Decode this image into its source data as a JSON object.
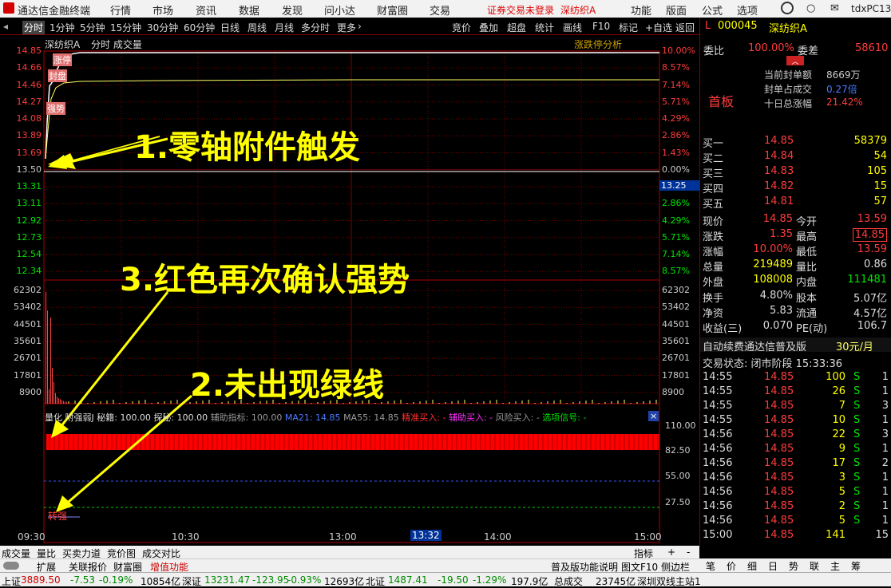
{
  "menubar": {
    "app_title": "通达信金融终端",
    "items": [
      "行情",
      "市场",
      "资讯",
      "数据",
      "发现",
      "问小达",
      "财富圈",
      "交易"
    ],
    "alert": "证券交易未登录",
    "stock": "深纺织A",
    "right_items": [
      "功能",
      "版面",
      "公式",
      "选项"
    ],
    "user": "tdxPC13"
  },
  "period_bar": {
    "items": [
      "分时",
      "1分钟",
      "5分钟",
      "15分钟",
      "30分钟",
      "60分钟",
      "日线",
      "周线",
      "月线",
      "多分时",
      "更多"
    ],
    "tools": [
      "竞价",
      "叠加",
      "超盘",
      "统计",
      "画线",
      "F10",
      "标记",
      "+自选",
      "返回"
    ]
  },
  "chart": {
    "header": "深纺织A",
    "header2": "分时 成交量",
    "limit_link": "涨跌停分析",
    "price_ticks": [
      "14.85",
      "14.66",
      "14.46",
      "14.27",
      "14.08",
      "13.89",
      "13.69",
      "13.50",
      "13.31",
      "13.11",
      "12.92",
      "12.73",
      "12.54",
      "12.34"
    ],
    "pct_ticks": [
      "10.00%",
      "8.57%",
      "7.14%",
      "5.71%",
      "4.29%",
      "2.86%",
      "1.43%",
      "0.00%",
      "1.43%",
      "2.86%",
      "4.29%",
      "5.71%",
      "7.14%",
      "8.57%"
    ],
    "cursor_price": "13.25",
    "vol_ticks": [
      "62302",
      "53402",
      "44501",
      "35601",
      "26701",
      "17801",
      "8900"
    ],
    "ind_ticks": [
      "110.00",
      "82.50",
      "55.00",
      "27.50"
    ],
    "time_ticks": [
      "09:30",
      "10:30",
      "13:00",
      "14:00",
      "15:00"
    ],
    "cursor_time": "13:32",
    "tags": [
      "涨停",
      "封盘",
      "强势"
    ],
    "indicator_line": [
      "量化",
      "附强弱J 秘籍: 100.00",
      "探秘: 100.00",
      "辅助指标: 100.00",
      "MA21: 14.85",
      "MA55: 14.85",
      "精准买入: -",
      "辅助买入: -",
      "风险买入: -",
      "选项信号: -"
    ],
    "indicator_tag": "转强",
    "notes": [
      "1.零轴附件触发",
      "3.红色再次确认强势",
      "2.未出现绿线"
    ]
  },
  "right": {
    "code": "000045",
    "name": "深纺织A",
    "weibi_label": "委比",
    "weibi": "100.00%",
    "weicha_label": "委差",
    "weicha": "58610",
    "seal_rows": [
      [
        "当前封单额",
        "8669万"
      ],
      [
        "封单占成交",
        "0.27倍"
      ],
      [
        "十日总涨幅",
        "21.42%"
      ]
    ],
    "board": "首板",
    "bids": [
      [
        "买一",
        "14.85",
        "58379"
      ],
      [
        "买二",
        "14.84",
        "54"
      ],
      [
        "买三",
        "14.83",
        "105"
      ],
      [
        "买四",
        "14.82",
        "15"
      ],
      [
        "买五",
        "14.81",
        "57"
      ]
    ],
    "quote": [
      [
        "现价",
        "14.85",
        "今开",
        "13.59"
      ],
      [
        "涨跌",
        "1.35",
        "最高",
        "14.85"
      ],
      [
        "涨幅",
        "10.00%",
        "最低",
        "13.59"
      ],
      [
        "总量",
        "219489",
        "量比",
        "0.86"
      ],
      [
        "外盘",
        "108008",
        "内盘",
        "111481"
      ],
      [
        "换手",
        "4.80%",
        "股本",
        "5.07亿"
      ],
      [
        "净资",
        "5.83",
        "流通",
        "4.57亿"
      ],
      [
        "收益(三)",
        "0.070",
        "PE(动)",
        "106.7"
      ]
    ],
    "ad": "自动续费通达信普及版",
    "ad_price": "30元/月",
    "trade_status": "交易状态: 闭市阶段 15:33:36",
    "ticks": [
      [
        "14:55",
        "14.85",
        "100",
        "S",
        "1"
      ],
      [
        "14:55",
        "14.85",
        "26",
        "S",
        "1"
      ],
      [
        "14:55",
        "14.85",
        "7",
        "S",
        "3"
      ],
      [
        "14:55",
        "14.85",
        "10",
        "S",
        "1"
      ],
      [
        "14:56",
        "14.85",
        "22",
        "S",
        "3"
      ],
      [
        "14:56",
        "14.85",
        "9",
        "S",
        "1"
      ],
      [
        "14:56",
        "14.85",
        "17",
        "S",
        "2"
      ],
      [
        "14:56",
        "14.85",
        "3",
        "S",
        "1"
      ],
      [
        "14:56",
        "14.85",
        "5",
        "S",
        "1"
      ],
      [
        "14:56",
        "14.85",
        "2",
        "S",
        "1"
      ],
      [
        "14:56",
        "14.85",
        "5",
        "S",
        "1"
      ],
      [
        "15:00",
        "14.85",
        "141",
        "",
        "15"
      ]
    ]
  },
  "tabs": [
    "成交量",
    "量比",
    "买卖力道",
    "竞价图",
    "成交对比"
  ],
  "tabs_right": [
    "指标",
    "+",
    "-"
  ],
  "tabs2": [
    "扩展",
    "关联报价",
    "财富圈",
    "增值功能"
  ],
  "tabs2_right": [
    "普及版功能说明",
    "图文F10",
    "侧边栏"
  ],
  "rtabs": [
    "笔",
    "价",
    "细",
    "日",
    "势",
    "联",
    "主",
    "筹"
  ],
  "status": [
    "上证",
    "3889.50",
    "-7.53",
    "-0.19%",
    "10854亿",
    "深证",
    "13231.47",
    "-123.95",
    "-0.93%",
    "12693亿",
    "北证",
    "1487.41",
    "-19.50",
    "-1.29%",
    "197.9亿",
    "总成交",
    "23745亿",
    "深圳双线主站1"
  ]
}
